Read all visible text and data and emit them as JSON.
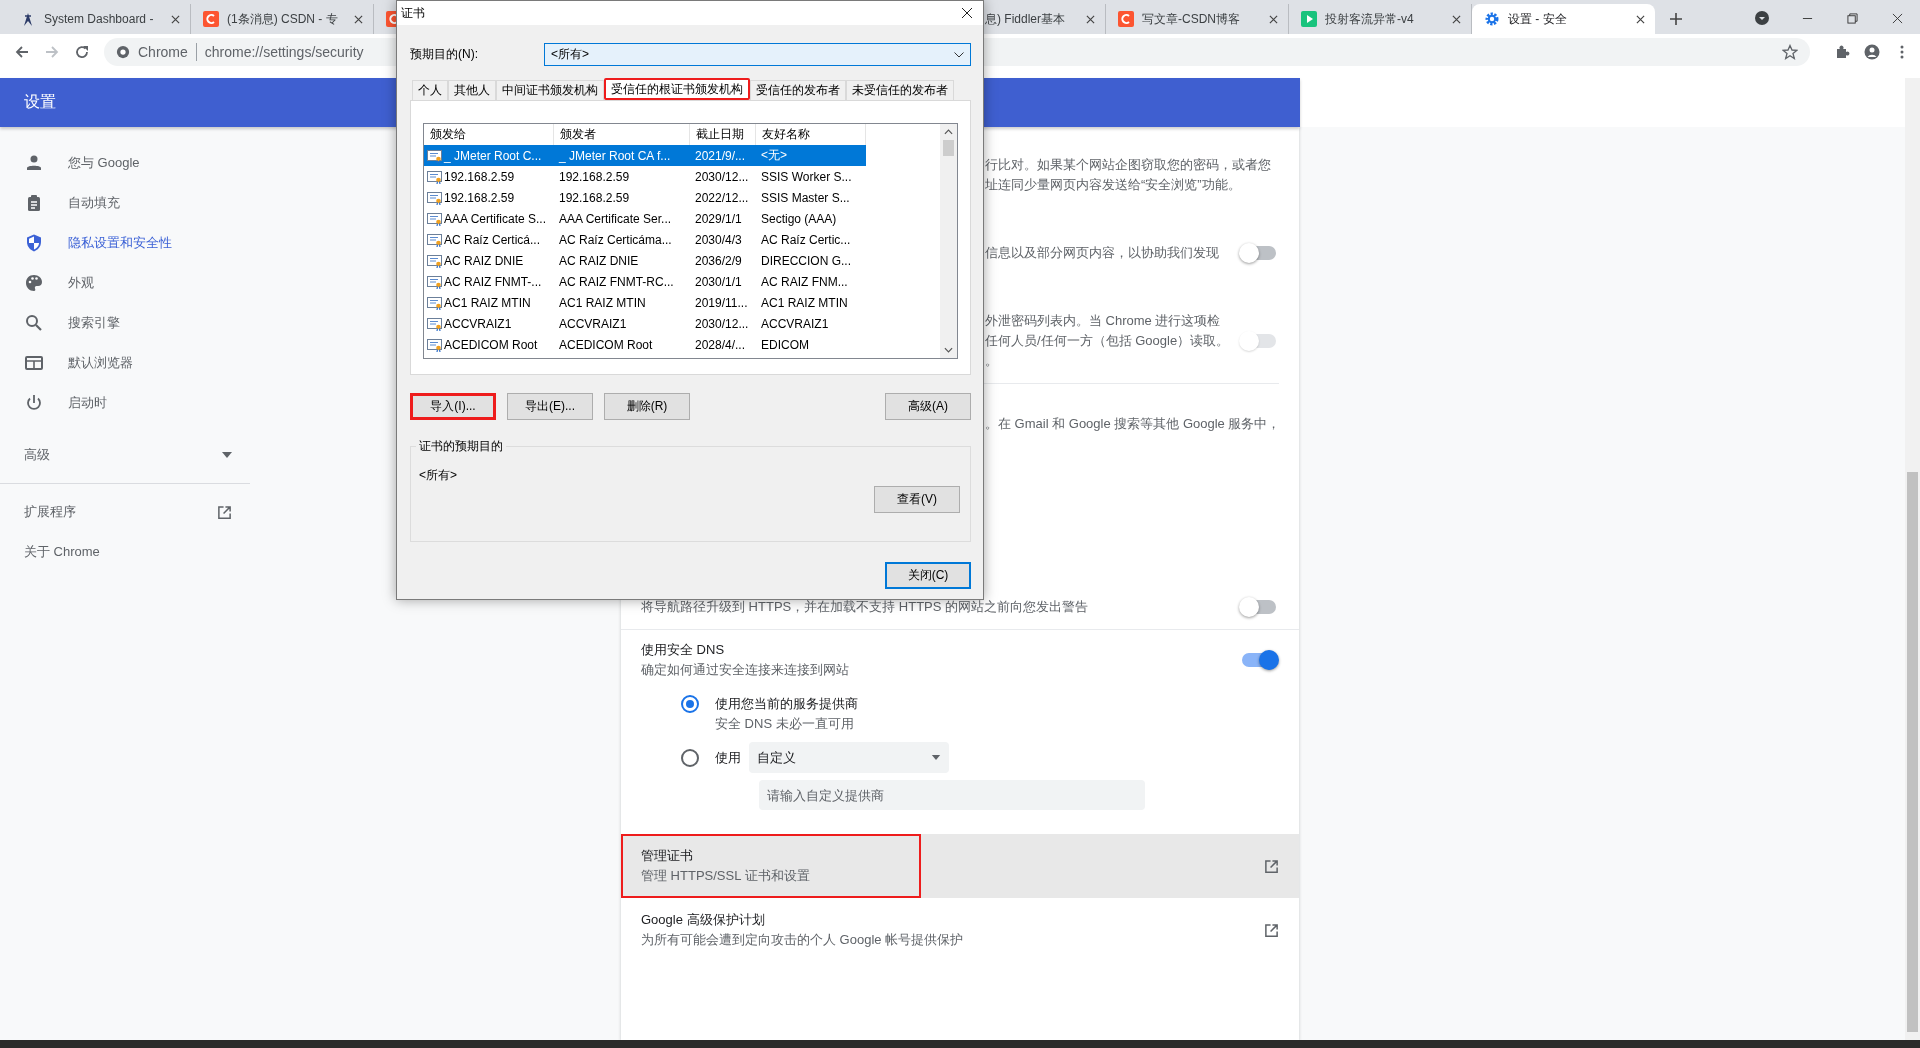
{
  "browser": {
    "tabs_left": [
      {
        "title": "System Dashboard -",
        "selected": false
      },
      {
        "title": "(1条消息) CSDN - 专",
        "selected": false
      },
      {
        "selected": false
      }
    ],
    "tabs_right": [
      {
        "title": "息) Fiddler基本",
        "selected": false
      },
      {
        "title": "写文章-CSDN博客",
        "selected": false
      },
      {
        "title": "投射客流异常-v4",
        "selected": false
      },
      {
        "title": "设置 - 安全",
        "selected": true
      }
    ],
    "omnibox": {
      "chip": "Chrome",
      "url": "chrome://settings/security"
    }
  },
  "settings": {
    "title": "设置",
    "nav": [
      {
        "label": "您与 Google",
        "selected": false
      },
      {
        "label": "自动填充",
        "selected": false
      },
      {
        "label": "隐私设置和安全性",
        "selected": true
      },
      {
        "label": "外观",
        "selected": false
      },
      {
        "label": "搜索引擎",
        "selected": false
      },
      {
        "label": "默认浏览器",
        "selected": false
      },
      {
        "label": "启动时",
        "selected": false
      }
    ],
    "advanced": {
      "label": "高级",
      "expanded": false
    },
    "links": [
      {
        "label": "扩展程序"
      },
      {
        "label": "关于 Chrome"
      }
    ],
    "upper_sections": [
      {
        "kind": "text",
        "lines": [
          "行比对。如果某个网站企图窃取您的密码，或者您",
          "址连同少量网页内容发送给“安全浏览”功能。"
        ]
      },
      {
        "kind": "toggle",
        "lines": [
          "信息以及部分网页内容，以协助我们发现"
        ],
        "on": false,
        "disabled": false
      },
      {
        "kind": "toggle",
        "lines": [
          "外泄密码列表内。当 Chrome 进行这项检",
          "任何人员/任何一方（包括 Google）读取。",
          "。"
        ],
        "on": false,
        "disabled": true
      },
      {
        "kind": "divider"
      },
      {
        "kind": "text",
        "lines": [
          "。在 Gmail 和 Google 搜索等其他 Google 服务中，"
        ]
      }
    ],
    "https_row": {
      "text": "将导航路径升级到 HTTPS，并在加载不支持 HTTPS 的网站之前向您发出警告",
      "on": false
    },
    "dns": {
      "title": "使用安全 DNS",
      "subtitle": "确定如何通过安全连接来连接到网站",
      "on": true,
      "options": [
        {
          "kind": "current",
          "label": "使用您当前的服务提供商",
          "hint": "安全 DNS 未必一直可用",
          "selected": true
        },
        {
          "kind": "custom",
          "label": "使用",
          "dropdown": "自定义",
          "placeholder": "请输入自定义提供商",
          "selected": false
        }
      ]
    },
    "link_rows": [
      {
        "title": "管理证书",
        "subtitle": "管理 HTTPS/SSL 证书和设置",
        "hovered": true,
        "highlighted": true
      },
      {
        "title": "Google 高级保护计划",
        "subtitle": "为所有可能会遭到定向攻击的个人 Google 帐号提供保护",
        "hovered": false,
        "highlighted": false
      }
    ]
  },
  "dialog": {
    "title": "证书",
    "purpose_label": "预期目的(N):",
    "purpose_value": "<所有>",
    "tabs": [
      {
        "label": "个人",
        "selected": false,
        "highlighted": false
      },
      {
        "label": "其他人",
        "selected": false,
        "highlighted": false
      },
      {
        "label": "中间证书颁发机构",
        "selected": false,
        "highlighted": false
      },
      {
        "label": "受信任的根证书颁发机构",
        "selected": true,
        "highlighted": true
      },
      {
        "label": "受信任的发布者",
        "selected": false,
        "highlighted": false
      },
      {
        "label": "未受信任的发布者",
        "selected": false,
        "highlighted": false
      }
    ],
    "columns": [
      "颁发给",
      "颁发者",
      "截止日期",
      "友好名称"
    ],
    "rows": [
      {
        "cells": [
          "_ JMeter Root C...",
          "_ JMeter Root CA f...",
          "2021/9/...",
          "<无>"
        ],
        "selected": true
      },
      {
        "cells": [
          "192.168.2.59",
          "192.168.2.59",
          "2030/12...",
          "SSIS Worker S..."
        ],
        "selected": false
      },
      {
        "cells": [
          "192.168.2.59",
          "192.168.2.59",
          "2022/12...",
          "SSIS Master S..."
        ],
        "selected": false
      },
      {
        "cells": [
          "AAA Certificate S...",
          "AAA Certificate Ser...",
          "2029/1/1",
          "Sectigo (AAA)"
        ],
        "selected": false
      },
      {
        "cells": [
          "AC Raíz Certicá...",
          "AC Raíz Certicáma...",
          "2030/4/3",
          "AC Raíz Certic..."
        ],
        "selected": false
      },
      {
        "cells": [
          "AC RAIZ DNIE",
          "AC RAIZ DNIE",
          "2036/2/9",
          "DIRECCION G..."
        ],
        "selected": false
      },
      {
        "cells": [
          "AC RAIZ FNMT-...",
          "AC RAIZ FNMT-RC...",
          "2030/1/1",
          "AC RAIZ FNM..."
        ],
        "selected": false
      },
      {
        "cells": [
          "AC1 RAIZ MTIN",
          "AC1 RAIZ MTIN",
          "2019/11...",
          "AC1 RAIZ MTIN"
        ],
        "selected": false
      },
      {
        "cells": [
          "ACCVRAIZ1",
          "ACCVRAIZ1",
          "2030/12...",
          "ACCVRAIZ1"
        ],
        "selected": false
      },
      {
        "cells": [
          "ACEDICOM Root",
          "ACEDICOM Root",
          "2028/4/...",
          "EDICOM"
        ],
        "selected": false
      }
    ],
    "buttons": [
      {
        "label": "导入(I)...",
        "highlighted": true
      },
      {
        "label": "导出(E)...",
        "highlighted": false
      },
      {
        "label": "删除(R)",
        "highlighted": false
      },
      {
        "label": "高级(A)",
        "highlighted": false
      }
    ],
    "purpose_group": {
      "title": "证书的预期目的",
      "value": "<所有>",
      "button": "查看(V)"
    },
    "close_button": "关闭(C)"
  }
}
